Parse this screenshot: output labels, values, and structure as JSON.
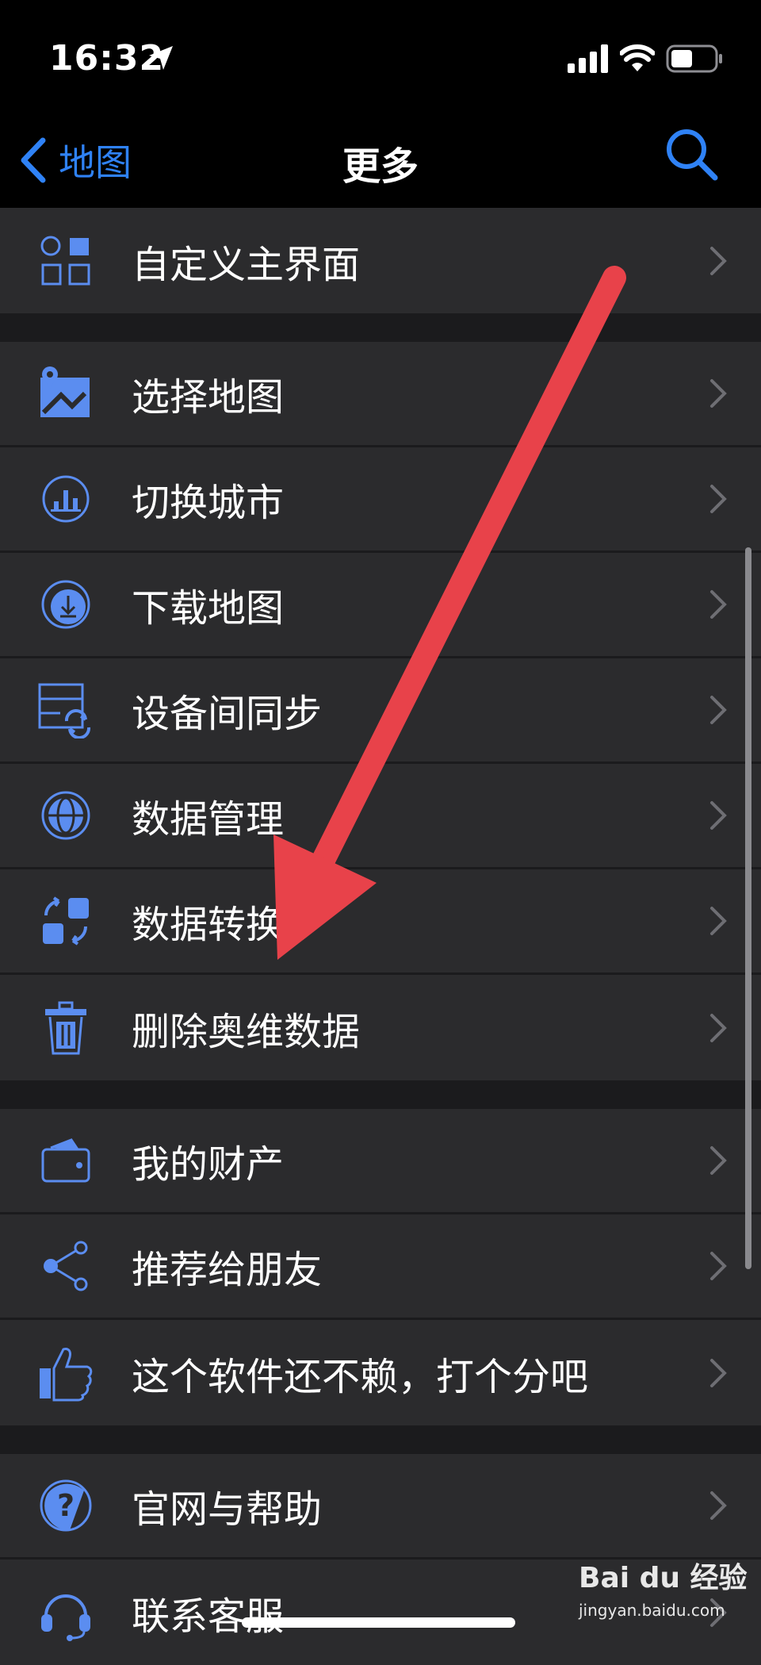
{
  "status": {
    "time": "16:32"
  },
  "nav": {
    "back_label": "地图",
    "title": "更多"
  },
  "sections": [
    [
      {
        "label": "自定义主界面",
        "icon": "grid-layout-icon"
      }
    ],
    [
      {
        "label": "选择地图",
        "icon": "map-pin-icon"
      },
      {
        "label": "切换城市",
        "icon": "city-skyline-icon"
      },
      {
        "label": "下载地图",
        "icon": "download-icon"
      },
      {
        "label": "设备间同步",
        "icon": "sync-devices-icon"
      },
      {
        "label": "数据管理",
        "icon": "globe-icon"
      },
      {
        "label": "数据转换",
        "icon": "convert-icon"
      },
      {
        "label": "删除奥维数据",
        "icon": "trash-icon"
      }
    ],
    [
      {
        "label": "我的财产",
        "icon": "wallet-icon"
      },
      {
        "label": "推荐给朋友",
        "icon": "share-icon"
      },
      {
        "label": "这个软件还不赖，打个分吧",
        "icon": "thumbs-up-icon"
      }
    ],
    [
      {
        "label": "官网与帮助",
        "icon": "help-icon"
      },
      {
        "label": "联系客服",
        "icon": "headset-icon"
      }
    ]
  ],
  "watermark": {
    "brand": "Bai du 经验",
    "url": "jingyan.baidu.com"
  },
  "colors": {
    "accent": "#2f82f6",
    "annotation_arrow": "#e8424a"
  }
}
